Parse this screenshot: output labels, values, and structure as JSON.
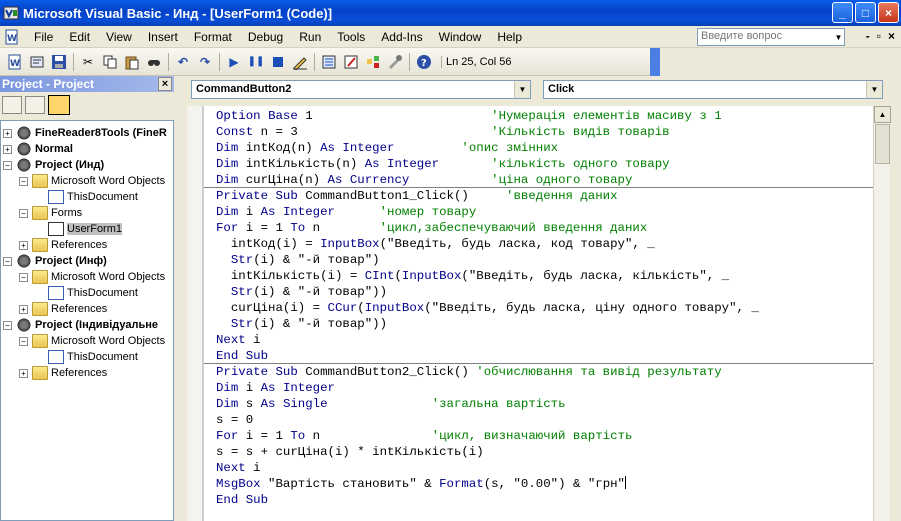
{
  "window": {
    "title": "Microsoft Visual Basic - Инд - [UserForm1 (Code)]",
    "minimize": "_",
    "maximize": "□",
    "close": "×"
  },
  "menubar": {
    "items": [
      "File",
      "Edit",
      "View",
      "Insert",
      "Format",
      "Debug",
      "Run",
      "Tools",
      "Add-Ins",
      "Window",
      "Help"
    ],
    "ask_placeholder": "Введите вопрос",
    "mdi_min": "-",
    "mdi_restore": "▫",
    "mdi_close": "×"
  },
  "toolbar": {
    "status": "Ln 25, Col 56"
  },
  "project": {
    "title": "Project - Project",
    "close": "×",
    "tree": [
      {
        "label": "FineReader8Tools (FineR",
        "exp": "+",
        "icon": "vba",
        "bold": true
      },
      {
        "label": "Normal",
        "exp": "+",
        "icon": "vba",
        "bold": true
      },
      {
        "label": "Project (Инд)",
        "exp": "−",
        "icon": "vba",
        "bold": true
      },
      {
        "label": "Microsoft Word Objects",
        "exp": "−",
        "icon": "folder"
      },
      {
        "label": "ThisDocument",
        "icon": "doc"
      },
      {
        "label": "Forms",
        "exp": "−",
        "icon": "folder"
      },
      {
        "label": "UserForm1",
        "icon": "form",
        "selected": true
      },
      {
        "label": "References",
        "exp": "+",
        "icon": "folder"
      },
      {
        "label": "Project (Инф)",
        "exp": "−",
        "icon": "vba",
        "bold": true
      },
      {
        "label": "Microsoft Word Objects",
        "exp": "−",
        "icon": "folder"
      },
      {
        "label": "ThisDocument",
        "icon": "doc"
      },
      {
        "label": "References",
        "exp": "+",
        "icon": "folder"
      },
      {
        "label": "Project (Індивідуальне",
        "exp": "−",
        "icon": "vba",
        "bold": true
      },
      {
        "label": "Microsoft Word Objects",
        "exp": "−",
        "icon": "folder"
      },
      {
        "label": "ThisDocument",
        "icon": "doc"
      },
      {
        "label": "References",
        "exp": "+",
        "icon": "folder"
      }
    ]
  },
  "code_window": {
    "object_combo": "CommandButton2",
    "proc_combo": "Click",
    "lines": [
      "Option Base 1                        'Нумерація елементів масиву з 1",
      "Const n = 3                          'Кількість видів товарів",
      "Dim intКод(n) As Integer         'опис змінних",
      "Dim intКількість(n) As Integer       'кількість одного товару",
      "Dim curЦіна(n) As Currency           'ціна одного товару",
      "Private Sub CommandButton1_Click()     'введення даних",
      "Dim i As Integer      'номер товару",
      "For i = 1 To n        'цикл,забеспечуваючий введення даних",
      "  intКод(i) = InputBox(\"Введіть, будь ласка, код товару\", _",
      "  Str(i) & \"-й товар\")",
      "  intКількість(i) = CInt(InputBox(\"Введіть, будь ласка, кількість\", _",
      "  Str(i) & \"-й товар\"))",
      "  curЦіна(i) = CCur(InputBox(\"Введіть, будь ласка, ціну одного товару\", _",
      "  Str(i) & \"-й товар\"))",
      "Next i",
      "End Sub",
      "Private Sub CommandButton2_Click() 'обчислювання та вивід результату",
      "Dim i As Integer",
      "Dim s As Single              'загальна вартість",
      "s = 0",
      "For i = 1 To n               'цикл, визначаючий вартість",
      "s = s + curЦіна(i) * intКількість(i)",
      "Next i",
      "MsgBox \"Вартість становить\" & Format(s, \"0.00\") & \"грн\"",
      "End Sub"
    ]
  }
}
